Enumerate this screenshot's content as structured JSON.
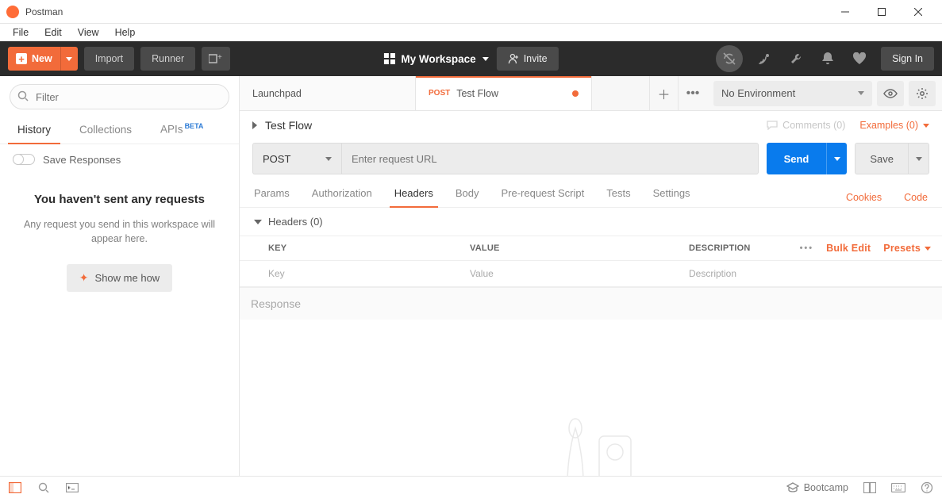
{
  "app": {
    "title": "Postman"
  },
  "menu": {
    "file": "File",
    "edit": "Edit",
    "view": "View",
    "help": "Help"
  },
  "toolbar": {
    "new": "New",
    "import": "Import",
    "runner": "Runner",
    "workspace": "My Workspace",
    "invite": "Invite",
    "signin": "Sign In"
  },
  "sidebar": {
    "filter_placeholder": "Filter",
    "tabs": {
      "history": "History",
      "collections": "Collections",
      "apis": "APIs"
    },
    "apis_badge": "BETA",
    "save_responses": "Save Responses",
    "empty_title": "You haven't sent any requests",
    "empty_body": "Any request you send in this workspace will appear here.",
    "show_me": "Show me how"
  },
  "tabs": [
    {
      "label": "Launchpad",
      "method": "",
      "active": false,
      "unsaved": false
    },
    {
      "label": "Test Flow",
      "method": "POST",
      "active": true,
      "unsaved": true
    }
  ],
  "environment": {
    "selected": "No Environment"
  },
  "request": {
    "name": "Test Flow",
    "comments_label": "Comments (0)",
    "examples_label": "Examples (0)",
    "method": "POST",
    "url_placeholder": "Enter request URL",
    "send": "Send",
    "save": "Save",
    "tabs": {
      "params": "Params",
      "authorization": "Authorization",
      "headers": "Headers",
      "body": "Body",
      "prerequest": "Pre-request Script",
      "tests": "Tests",
      "settings": "Settings"
    },
    "cookies": "Cookies",
    "code": "Code",
    "headers_section": "Headers  (0)",
    "table": {
      "key_header": "KEY",
      "value_header": "VALUE",
      "desc_header": "DESCRIPTION",
      "bulk_edit": "Bulk Edit",
      "presets": "Presets",
      "key_placeholder": "Key",
      "value_placeholder": "Value",
      "desc_placeholder": "Description"
    }
  },
  "response": {
    "label": "Response"
  },
  "statusbar": {
    "bootcamp": "Bootcamp"
  }
}
